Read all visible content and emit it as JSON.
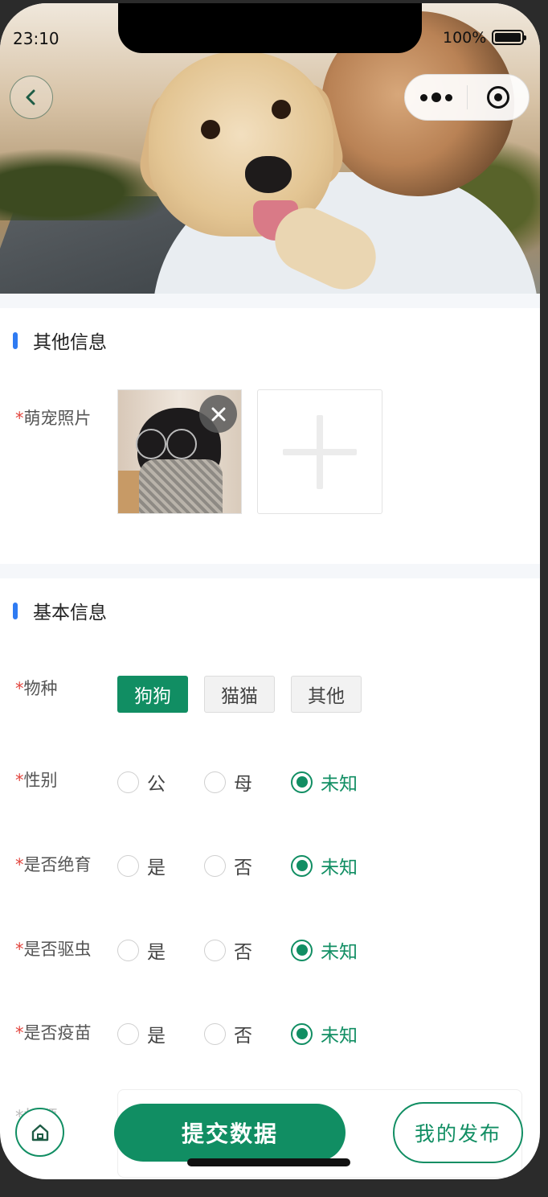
{
  "status_bar": {
    "time": "23:10",
    "battery": "100%"
  },
  "sections": {
    "other": {
      "title": "其他信息",
      "photo_label": "萌宠照片"
    },
    "basic": {
      "title": "基本信息",
      "species": {
        "label": "物种",
        "options": [
          "狗狗",
          "猫猫",
          "其他"
        ],
        "selected": "狗狗"
      },
      "gender": {
        "label": "性别",
        "options": [
          "公",
          "母",
          "未知"
        ],
        "selected": "未知"
      },
      "neutered": {
        "label": "是否绝育",
        "options": [
          "是",
          "否",
          "未知"
        ],
        "selected": "未知"
      },
      "dewormed": {
        "label": "是否驱虫",
        "options": [
          "是",
          "否",
          "未知"
        ],
        "selected": "未知"
      },
      "vaccinated": {
        "label": "是否疫苗",
        "options": [
          "是",
          "否",
          "未知"
        ],
        "selected": "未知"
      },
      "title_field": {
        "label": "标题"
      }
    }
  },
  "required_mark": "*",
  "bottom_bar": {
    "submit": "提交数据",
    "my_posts": "我的发布"
  },
  "colors": {
    "accent": "#118e63",
    "section_bar": "#2f7bf2",
    "required": "#e2463f"
  }
}
